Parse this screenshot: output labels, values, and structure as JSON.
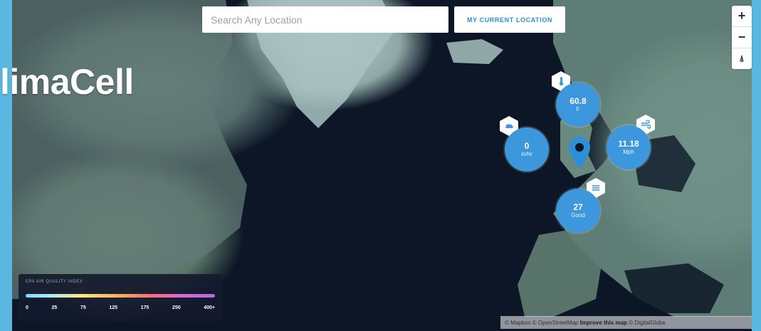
{
  "app": {
    "title": "limaCell"
  },
  "search": {
    "placeholder": "Search Any Location"
  },
  "location_button": {
    "label": "MY CURRENT LOCATION"
  },
  "zoom": {
    "in": "+",
    "out": "−",
    "reset": "⍋"
  },
  "bubbles": [
    {
      "name": "temperature",
      "value": "60.8",
      "unit": "F",
      "icon": "thermometer-icon"
    },
    {
      "name": "precipitation",
      "value": "0",
      "unit": "in/hr",
      "icon": "rain-icon"
    },
    {
      "name": "wind",
      "value": "11.18",
      "unit": "Mph",
      "icon": "wind-icon"
    },
    {
      "name": "air-quality",
      "value": "27",
      "unit": "Good",
      "icon": "air-quality-icon"
    }
  ],
  "legend": {
    "title": "EPA AIR QUALITY INDEX",
    "ticks": [
      "0",
      "25",
      "75",
      "125",
      "175",
      "250",
      "400+"
    ]
  },
  "attribution": {
    "text": "© Mapbox © OpenStreetMap",
    "link": "Improve this map",
    "extra": "© DigitalGlobe"
  },
  "colors": {
    "frame": "#59b7e2",
    "bubble": "#3d97dc",
    "marker": "#2f8fd6",
    "ocean": "#0c1626"
  }
}
